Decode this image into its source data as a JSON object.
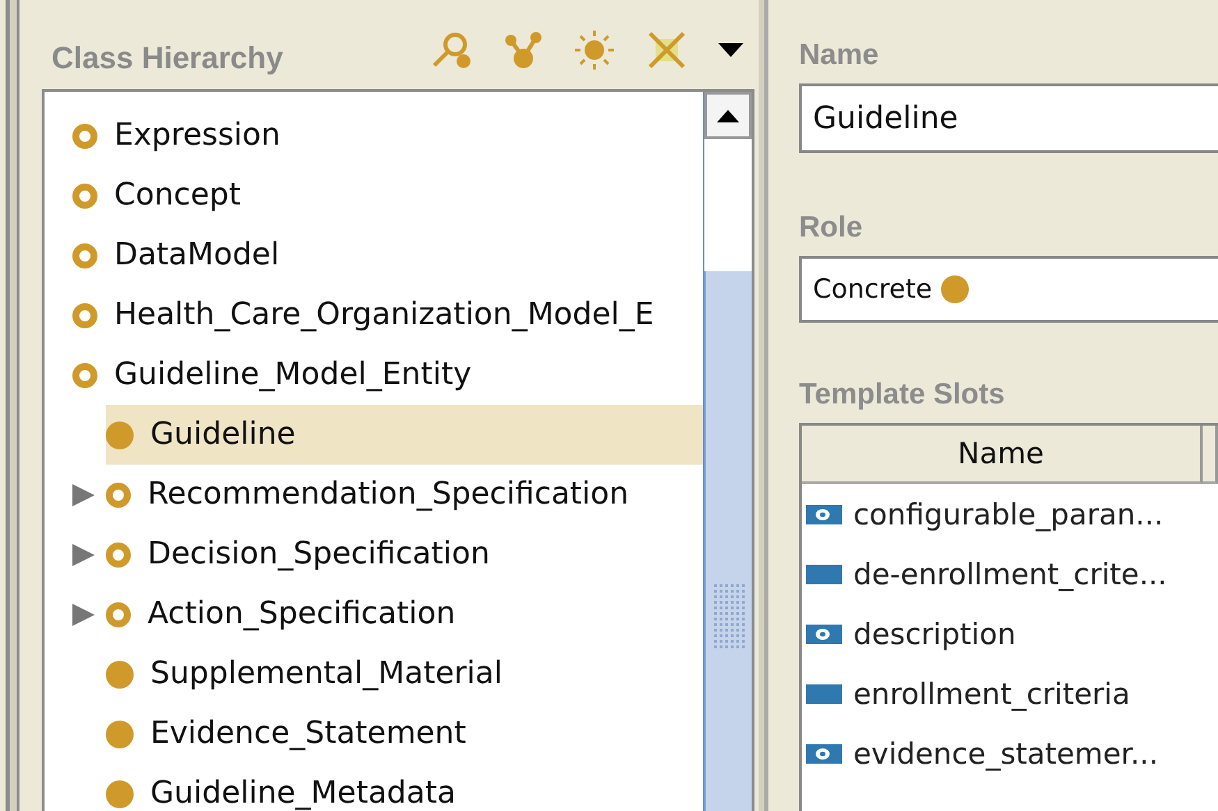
{
  "class_hierarchy": {
    "title": "Class Hierarchy",
    "tree": [
      {
        "label": "Expression",
        "kind": "abstract",
        "selected": false
      },
      {
        "label": "Concept",
        "kind": "abstract",
        "selected": false
      },
      {
        "label": "DataModel",
        "kind": "abstract",
        "selected": false
      },
      {
        "label": "Health_Care_Organization_Model_E",
        "kind": "abstract",
        "selected": false
      },
      {
        "label": "Guideline_Model_Entity",
        "kind": "abstract",
        "selected": false,
        "children": [
          {
            "label": "Guideline",
            "kind": "concrete",
            "selected": true,
            "expandable": false
          },
          {
            "label": "Recommendation_Specification",
            "kind": "abstract",
            "selected": false,
            "expandable": true
          },
          {
            "label": "Decision_Specification",
            "kind": "abstract",
            "selected": false,
            "expandable": true
          },
          {
            "label": "Action_Specification",
            "kind": "abstract",
            "selected": false,
            "expandable": true
          },
          {
            "label": "Supplemental_Material",
            "kind": "concrete",
            "selected": false,
            "expandable": false
          },
          {
            "label": "Evidence_Statement",
            "kind": "concrete",
            "selected": false,
            "expandable": false
          },
          {
            "label": "Guideline_Metadata",
            "kind": "concrete",
            "selected": false,
            "expandable": false
          }
        ]
      }
    ]
  },
  "name": {
    "label": "Name",
    "value": "Guideline"
  },
  "role": {
    "label": "Role",
    "value": "Concrete",
    "kind": "concrete"
  },
  "template_slots": {
    "title": "Template Slots",
    "columns": [
      "Name"
    ],
    "rows": [
      {
        "kind": "ring",
        "cells": [
          "configurable_paran..."
        ]
      },
      {
        "kind": "bar",
        "cells": [
          "de-enrollment_crite..."
        ]
      },
      {
        "kind": "ring",
        "cells": [
          "description"
        ]
      },
      {
        "kind": "bar",
        "cells": [
          "enrollment_criteria"
        ]
      },
      {
        "kind": "ring",
        "cells": [
          "evidence_statemer..."
        ]
      }
    ]
  }
}
